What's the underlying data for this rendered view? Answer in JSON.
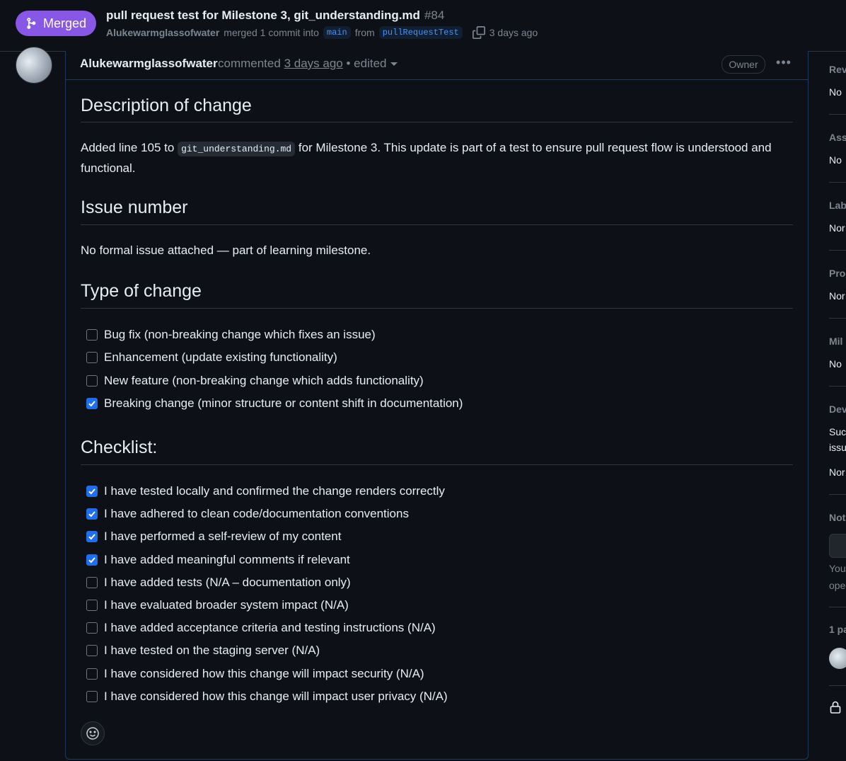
{
  "header": {
    "status_label": "Merged",
    "title": "pull request test for Milestone 3, git_understanding.md",
    "number": "#84",
    "author": "Alukewarmglassofwater",
    "merge_text": "merged 1 commit into",
    "base_branch": "main",
    "from_text": "from",
    "head_branch": "pullRequestTest",
    "time": "3 days ago"
  },
  "comment": {
    "author": "Alukewarmglassofwater",
    "action": "commented",
    "time": "3 days ago",
    "edited": "• edited",
    "role_badge": "Owner",
    "more_label": "•••",
    "sections": {
      "description": {
        "heading": "Description of change",
        "text_before": "Added line 105 to",
        "code": "git_understanding.md",
        "text_after": "for Milestone 3. This update is part of a test to ensure pull request flow is understood and functional."
      },
      "issue": {
        "heading": "Issue number",
        "text": "No formal issue attached — part of learning milestone."
      },
      "type": {
        "heading": "Type of change",
        "items": [
          {
            "label": "Bug fix (non-breaking change which fixes an issue)",
            "checked": false
          },
          {
            "label": "Enhancement (update existing functionality)",
            "checked": false
          },
          {
            "label": "New feature (non-breaking change which adds functionality)",
            "checked": false
          },
          {
            "label": "Breaking change (minor structure or content shift in documentation)",
            "checked": true
          }
        ]
      },
      "checklist": {
        "heading": "Checklist:",
        "items": [
          {
            "label": "I have tested locally and confirmed the change renders correctly",
            "checked": true
          },
          {
            "label": "I have adhered to clean code/documentation conventions",
            "checked": true
          },
          {
            "label": "I have performed a self-review of my content",
            "checked": true
          },
          {
            "label": "I have added meaningful comments if relevant",
            "checked": true
          },
          {
            "label": "I have added tests (N/A – documentation only)",
            "checked": false
          },
          {
            "label": "I have evaluated broader system impact (N/A)",
            "checked": false
          },
          {
            "label": "I have added acceptance criteria and testing instructions (N/A)",
            "checked": false
          },
          {
            "label": "I have tested on the staging server (N/A)",
            "checked": false
          },
          {
            "label": "I have considered how this change will impact security (N/A)",
            "checked": false
          },
          {
            "label": "I have considered how this change will impact user privacy (N/A)",
            "checked": false
          }
        ]
      }
    }
  },
  "sidebar": {
    "reviewers": {
      "heading": "Rev",
      "value": "No"
    },
    "assignees": {
      "heading": "Ass",
      "value": "No"
    },
    "labels": {
      "heading": "Lab",
      "value": "Nor"
    },
    "projects": {
      "heading": "Pro",
      "value": "Nor"
    },
    "milestone": {
      "heading": "Mil",
      "value": "No"
    },
    "development": {
      "heading": "Dev",
      "line1": "Suc",
      "line2": "issu",
      "value": "Nor"
    },
    "notifications": {
      "heading": "Not",
      "line1": "You",
      "line2": "ope"
    },
    "participants": {
      "heading": "1 pa"
    }
  },
  "colors": {
    "background": "#0d1117",
    "merged": "#8957e5",
    "checkbox_checked": "#1f6feb",
    "link": "#4493f8",
    "muted": "#7d8590"
  },
  "icons": [
    "git-merge-icon",
    "copy-icon",
    "kebab-horizontal-icon",
    "check-icon",
    "smiley-icon",
    "lock-icon"
  ]
}
